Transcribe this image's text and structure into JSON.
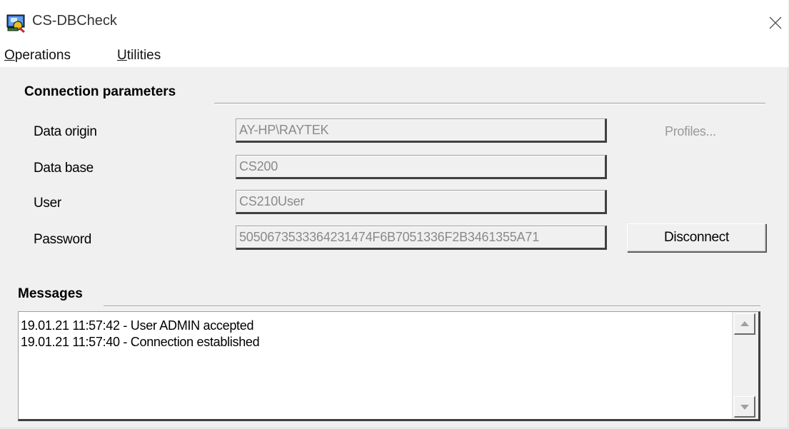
{
  "window": {
    "title": "CS-DBCheck",
    "close_icon": "close-icon"
  },
  "menu": {
    "items": [
      {
        "mnemonic": "O",
        "rest": "perations"
      },
      {
        "mnemonic": "U",
        "rest": "tilities"
      }
    ]
  },
  "connection": {
    "section_title": "Connection parameters",
    "fields": [
      {
        "label": "Data origin",
        "value": "AY-HP\\RAYTEK"
      },
      {
        "label": "Data base",
        "value": "CS200"
      },
      {
        "label": "User",
        "value": "CS210User"
      },
      {
        "label": "Password",
        "value": "5050673533364231474F6B7051336F2B3461355A71"
      }
    ],
    "profiles_label": "Profiles...",
    "disconnect_label": "Disconnect"
  },
  "messages": {
    "section_title": "Messages",
    "lines": [
      "19.01.21 11:57:42 - User ADMIN accepted",
      "19.01.21 11:57:40 - Connection established"
    ]
  },
  "colors": {
    "window_bg": "#f0f0f0",
    "titlebar_bg": "#ffffff",
    "disabled_text": "#8a8a8a"
  }
}
